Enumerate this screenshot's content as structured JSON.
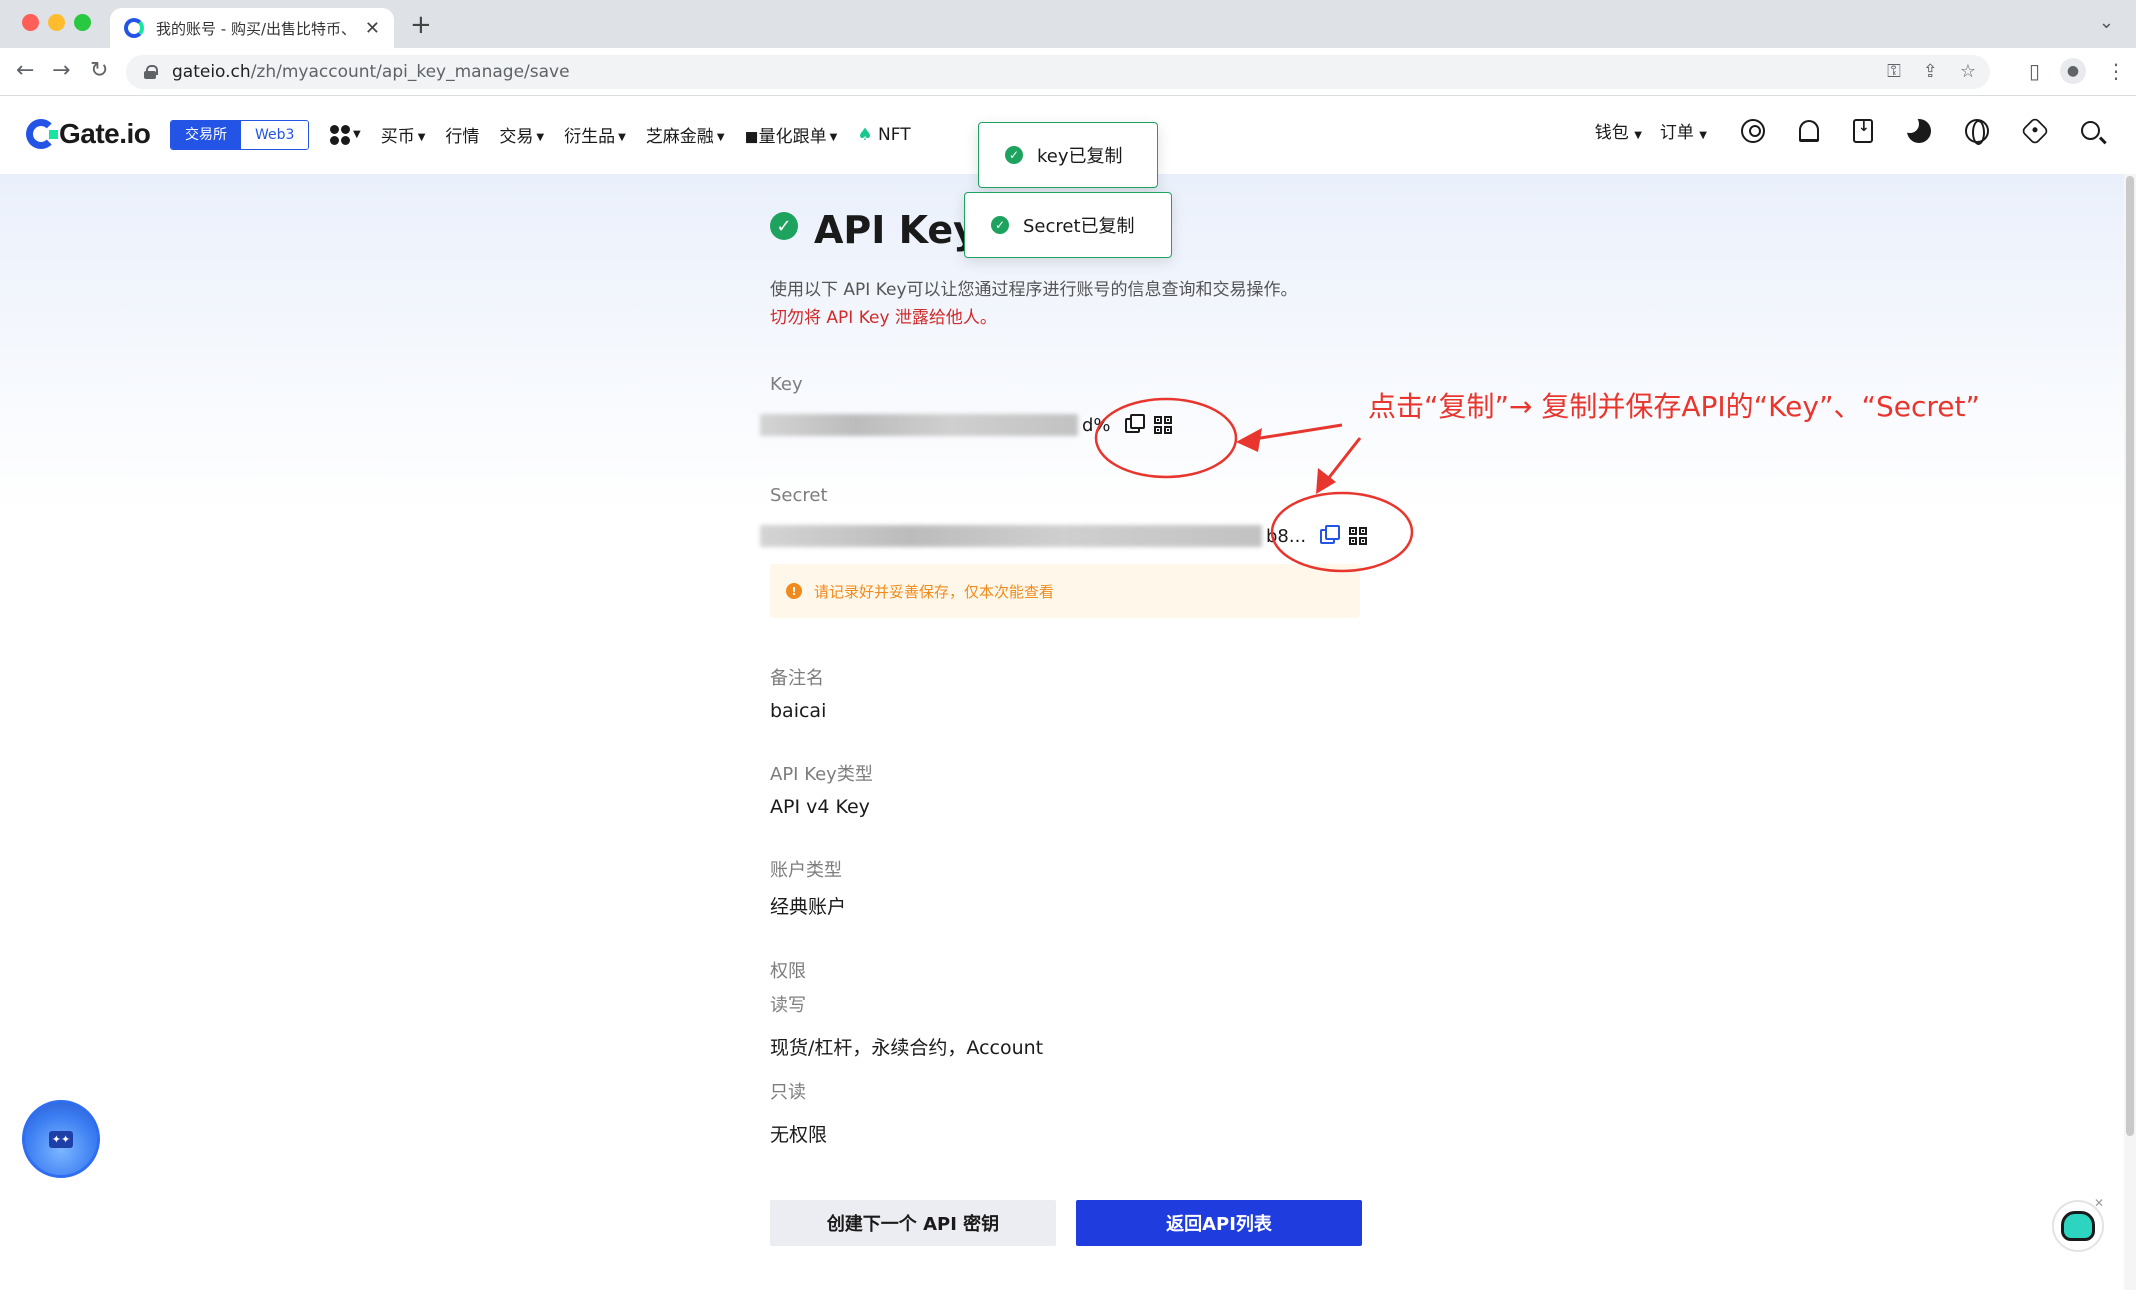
{
  "browser": {
    "tab_title": "我的账号 - 购买/出售比特币、以",
    "url_host": "gateio.ch",
    "url_path": "/zh/myaccount/api_key_manage/save"
  },
  "header": {
    "logo_text": "Gate.io",
    "switch": [
      "交易所",
      "Web3"
    ],
    "nav": [
      {
        "label": "买币"
      },
      {
        "label": "行情"
      },
      {
        "label": "交易"
      },
      {
        "label": "衍生品"
      },
      {
        "label": "芝麻金融"
      },
      {
        "label": "量化跟单"
      },
      {
        "label": "NFT"
      }
    ],
    "right": {
      "wallet": "钱包",
      "orders": "订单"
    }
  },
  "toasts": {
    "key_copied": "key已复制",
    "secret_copied": "Secret已复制"
  },
  "main": {
    "title": "API Key创",
    "desc": "使用以下 API Key可以让您通过程序进行账号的信息查询和交易操作。",
    "warn": "切勿将 API Key 泄露给他人。",
    "key_label": "Key",
    "key_tail": "d%",
    "secret_label": "Secret",
    "secret_tail": "b8...",
    "notice": "请记录好并妥善保存，仅本次能查看",
    "remark_label": "备注名",
    "remark_value": "baicai",
    "type_label": "API Key类型",
    "type_value": "API v4 Key",
    "account_label": "账户类型",
    "account_value": "经典账户",
    "perm_label": "权限",
    "rw_label": "读写",
    "rw_value": "现货/杠杆，永续合约，Account",
    "ro_label": "只读",
    "ro_value": "无权限",
    "btn_next": "创建下一个 API 密钥",
    "btn_back": "返回API列表"
  },
  "annotation": {
    "text": "点击“复制”→ 复制并保存API的“Key”、“Secret”",
    "color": "#e8362e"
  },
  "colors": {
    "brand": "#2354e6",
    "success": "#1ea35f",
    "primary_button": "#1f3cde",
    "warning": "#f08a1c"
  }
}
